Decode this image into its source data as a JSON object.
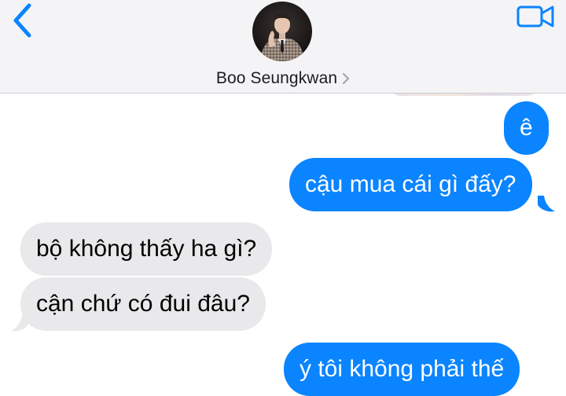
{
  "header": {
    "contact_name": "Boo Seungkwan",
    "back_icon": "chevron-left-icon",
    "video_icon": "video-camera-icon",
    "accent_color": "#0a84ff"
  },
  "messages": [
    {
      "direction": "sent",
      "text": "ê"
    },
    {
      "direction": "sent",
      "text": "cậu mua cái gì đấy?"
    },
    {
      "direction": "received",
      "text": "bộ không thấy ha gì?"
    },
    {
      "direction": "received",
      "text": "cận chứ có đui đâu?"
    },
    {
      "direction": "sent",
      "text": "ý tôi không phải thế"
    }
  ],
  "colors": {
    "sent_bubble": "#0a84ff",
    "received_bubble": "#e9e9eb",
    "header_bg": "#f4f4f6"
  }
}
